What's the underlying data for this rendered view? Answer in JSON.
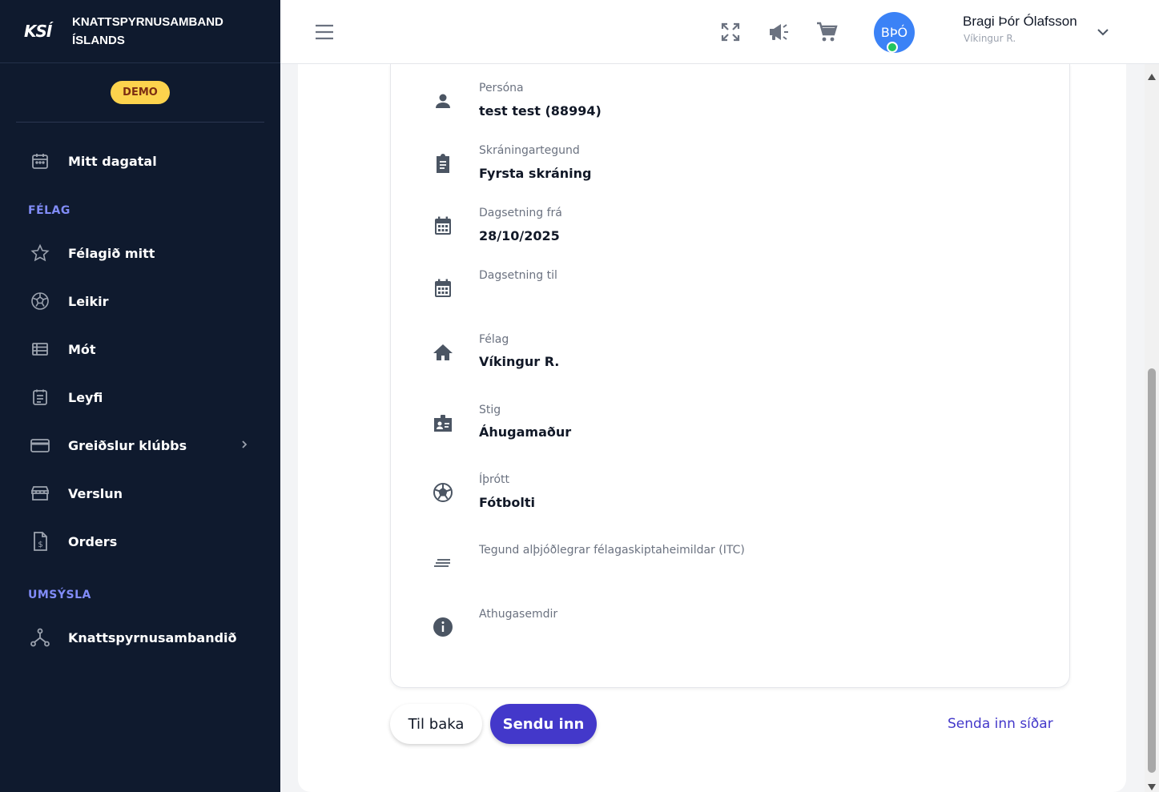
{
  "brand": {
    "logo": "KSÍ",
    "name_line1": "KNATTSPYRNUSAMBAND",
    "name_line2": "ÍSLANDS"
  },
  "demo_badge": "DEMO",
  "sidebar": {
    "calendar": "Mitt dagatal",
    "section_club": "FÉLAG",
    "club_items": [
      {
        "label": "Félagið mitt",
        "icon": "star-icon"
      },
      {
        "label": "Leikir",
        "icon": "soccer-ball-icon"
      },
      {
        "label": "Mót",
        "icon": "list-icon"
      },
      {
        "label": "Leyfi",
        "icon": "document-icon"
      },
      {
        "label": "Greiðslur klúbbs",
        "icon": "credit-card-icon"
      },
      {
        "label": "Verslun",
        "icon": "store-icon"
      },
      {
        "label": "Orders",
        "icon": "invoice-icon"
      }
    ],
    "section_admin": "UMSÝSLA",
    "admin_items": [
      {
        "label": "Knattspyrnusambandið",
        "icon": "hierarchy-icon"
      }
    ]
  },
  "header": {
    "avatar_initials": "BÞÓ",
    "user_name": "Bragi Þór Ólafsson",
    "user_club": "Víkingur R."
  },
  "fields": [
    {
      "label": "Persóna",
      "value": "test test (88994)",
      "icon": "person-icon"
    },
    {
      "label": "Skráningartegund",
      "value": "Fyrsta skráning",
      "icon": "clipboard-icon"
    },
    {
      "label": "Dagsetning frá",
      "value": "28/10/2025",
      "icon": "calendar-icon"
    },
    {
      "label": "Dagsetning til",
      "value": "",
      "icon": "calendar-icon"
    },
    {
      "label": "Félag",
      "value": "Víkingur R.",
      "icon": "home-icon"
    },
    {
      "label": "Stig",
      "value": "Áhugamaður",
      "icon": "badge-icon"
    },
    {
      "label": "Íþrótt",
      "value": "Fótbolti",
      "icon": "soccer-ball-icon"
    },
    {
      "label": "Tegund alþjóðlegrar félagaskiptaheimildar (ITC)",
      "value": "",
      "icon": "lines-icon"
    },
    {
      "label": "Athugasemdir",
      "value": "",
      "icon": "info-icon"
    }
  ],
  "actions": {
    "back": "Til baka",
    "submit": "Sendu inn",
    "submit_later": "Senda inn síðar"
  },
  "colors": {
    "sidebar_bg": "#0f1a2e",
    "accent": "#4338ca",
    "section": "#818cf8",
    "demo": "#fcd34d"
  }
}
